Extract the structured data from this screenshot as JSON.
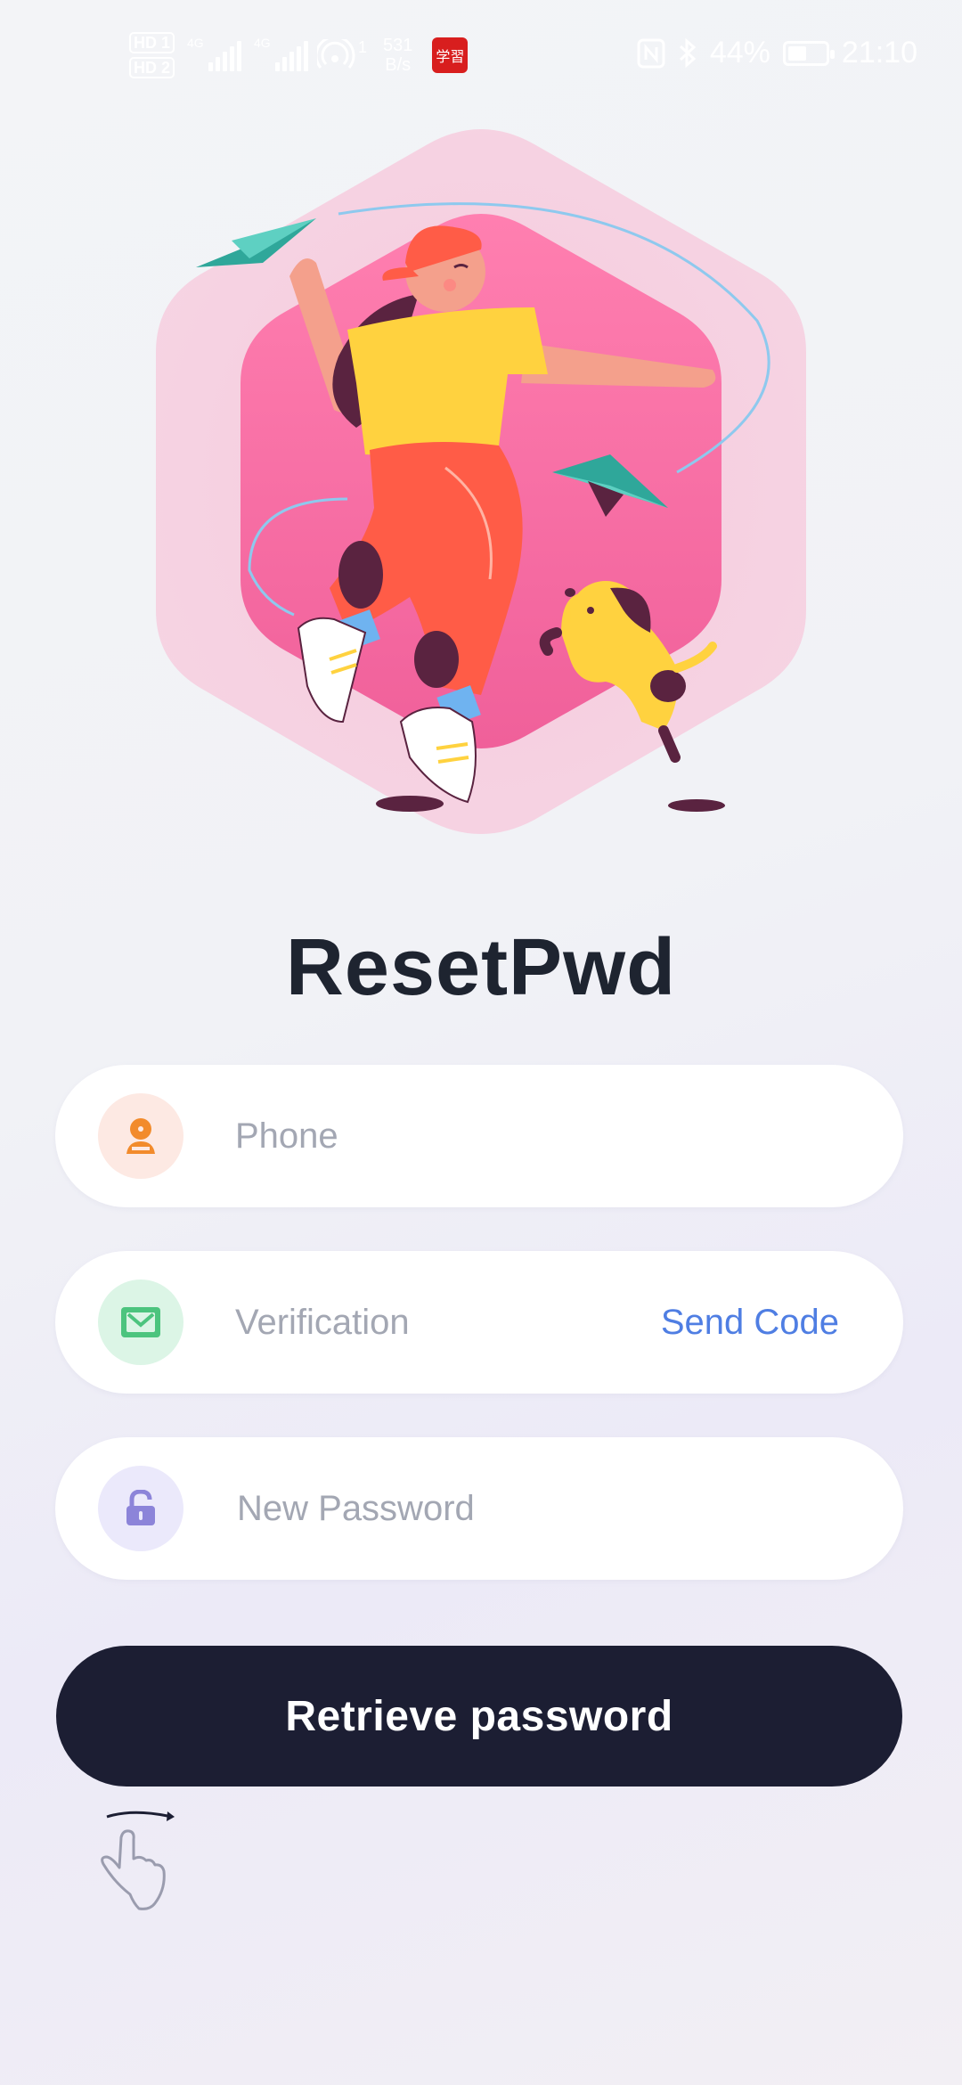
{
  "status_bar": {
    "hd1": "HD 1",
    "hd2": "HD 2",
    "net1": "4G",
    "net2": "4G",
    "hotspot_count": "1",
    "speed_value": "531",
    "speed_unit": "B/s",
    "app_badge": "学習",
    "battery": "44%",
    "time": "21:10",
    "battery_level": 0.44
  },
  "page": {
    "title": "ResetPwd"
  },
  "form": {
    "phone_placeholder": "Phone",
    "verification_placeholder": "Verification",
    "send_code_label": "Send Code",
    "password_placeholder": "New Password",
    "submit_label": "Retrieve password"
  },
  "icons": {
    "phone": "user-icon",
    "verification": "mail-icon",
    "password": "unlock-icon",
    "gesture": "swipe-gesture-icon"
  },
  "colors": {
    "phone_icon_bg": "#fde9e3",
    "phone_icon": "#f28b2c",
    "verification_icon_bg": "#dcf5e6",
    "verification_icon": "#4cc47e",
    "password_icon_bg": "#ebe9fb",
    "password_icon": "#8c84d9",
    "accent_link": "#4f7ee3",
    "button_bg": "#1c1e33",
    "title": "#1e2430"
  }
}
